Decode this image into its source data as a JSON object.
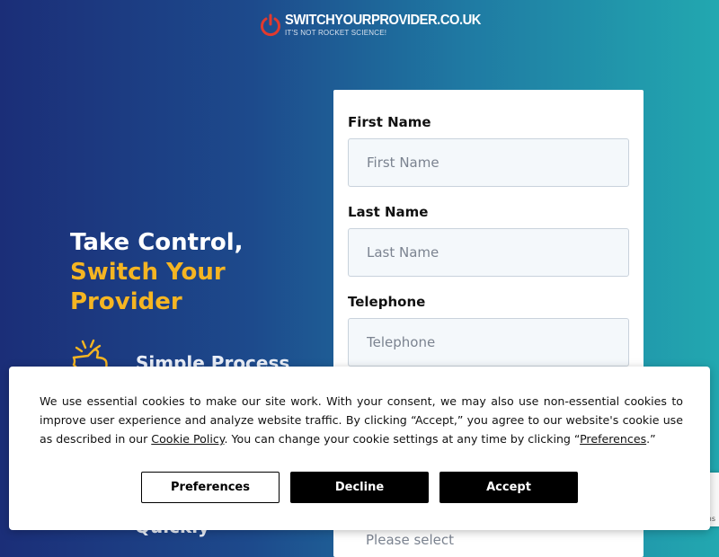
{
  "logo": {
    "name": "SWITCHYOURPROVIDER.CO.UK",
    "tagline": "IT'S NOT ROCKET SCIENCE!",
    "icon": "power-icon",
    "accent": "#e23a2e"
  },
  "hero": {
    "line1": "Take Control,",
    "line2": "Switch Your",
    "line3": "Provider",
    "highlight_color": "#f5b522"
  },
  "features": [
    {
      "label": "Simple Process",
      "icon": "pointing-hand-icon"
    },
    {
      "label": "Quickly"
    }
  ],
  "form": {
    "first_name": {
      "label": "First Name",
      "placeholder": "First Name"
    },
    "last_name": {
      "label": "Last Name",
      "placeholder": "Last Name"
    },
    "telephone": {
      "label": "Telephone",
      "placeholder": "Telephone"
    },
    "select_placeholder": "Please select"
  },
  "cookie_banner": {
    "text_before_link": "We use essential cookies to make our site work. With your consent, we may also use non-essential cookies to improve user experience and analyze website traffic. By clicking “Accept,” you agree to our website's cookie use as described in our ",
    "cookie_policy_link": "Cookie Policy",
    "text_middle": ". You can change your cookie settings at any time by clicking “",
    "preferences_link": "Preferences",
    "text_end": ".”",
    "preferences_button": "Preferences",
    "decline_button": "Decline",
    "accept_button": "Accept"
  },
  "recaptcha": {
    "text": "ms"
  }
}
